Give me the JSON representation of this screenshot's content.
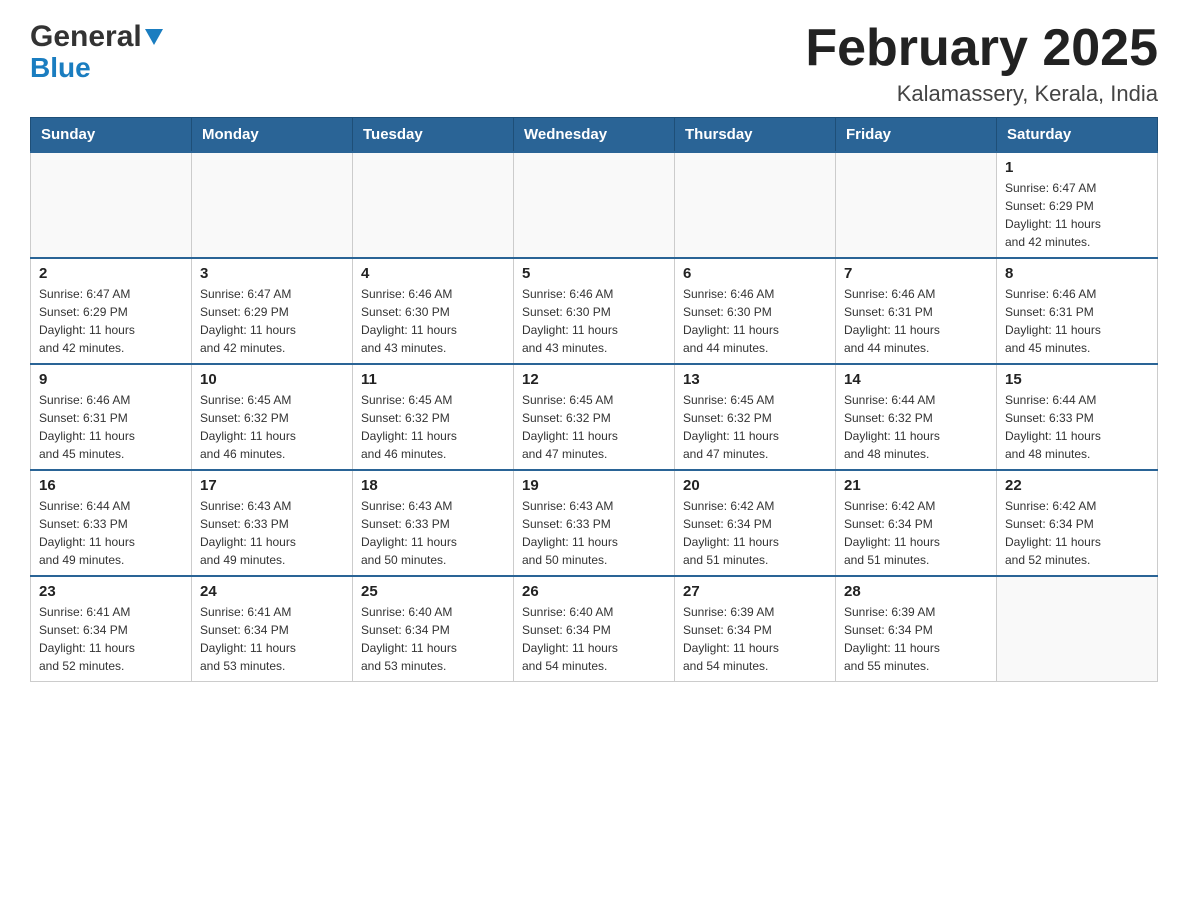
{
  "header": {
    "logo_general": "General",
    "logo_blue": "Blue",
    "title": "February 2025",
    "subtitle": "Kalamassery, Kerala, India"
  },
  "weekdays": [
    "Sunday",
    "Monday",
    "Tuesday",
    "Wednesday",
    "Thursday",
    "Friday",
    "Saturday"
  ],
  "weeks": [
    [
      {
        "day": "",
        "info": ""
      },
      {
        "day": "",
        "info": ""
      },
      {
        "day": "",
        "info": ""
      },
      {
        "day": "",
        "info": ""
      },
      {
        "day": "",
        "info": ""
      },
      {
        "day": "",
        "info": ""
      },
      {
        "day": "1",
        "info": "Sunrise: 6:47 AM\nSunset: 6:29 PM\nDaylight: 11 hours\nand 42 minutes."
      }
    ],
    [
      {
        "day": "2",
        "info": "Sunrise: 6:47 AM\nSunset: 6:29 PM\nDaylight: 11 hours\nand 42 minutes."
      },
      {
        "day": "3",
        "info": "Sunrise: 6:47 AM\nSunset: 6:29 PM\nDaylight: 11 hours\nand 42 minutes."
      },
      {
        "day": "4",
        "info": "Sunrise: 6:46 AM\nSunset: 6:30 PM\nDaylight: 11 hours\nand 43 minutes."
      },
      {
        "day": "5",
        "info": "Sunrise: 6:46 AM\nSunset: 6:30 PM\nDaylight: 11 hours\nand 43 minutes."
      },
      {
        "day": "6",
        "info": "Sunrise: 6:46 AM\nSunset: 6:30 PM\nDaylight: 11 hours\nand 44 minutes."
      },
      {
        "day": "7",
        "info": "Sunrise: 6:46 AM\nSunset: 6:31 PM\nDaylight: 11 hours\nand 44 minutes."
      },
      {
        "day": "8",
        "info": "Sunrise: 6:46 AM\nSunset: 6:31 PM\nDaylight: 11 hours\nand 45 minutes."
      }
    ],
    [
      {
        "day": "9",
        "info": "Sunrise: 6:46 AM\nSunset: 6:31 PM\nDaylight: 11 hours\nand 45 minutes."
      },
      {
        "day": "10",
        "info": "Sunrise: 6:45 AM\nSunset: 6:32 PM\nDaylight: 11 hours\nand 46 minutes."
      },
      {
        "day": "11",
        "info": "Sunrise: 6:45 AM\nSunset: 6:32 PM\nDaylight: 11 hours\nand 46 minutes."
      },
      {
        "day": "12",
        "info": "Sunrise: 6:45 AM\nSunset: 6:32 PM\nDaylight: 11 hours\nand 47 minutes."
      },
      {
        "day": "13",
        "info": "Sunrise: 6:45 AM\nSunset: 6:32 PM\nDaylight: 11 hours\nand 47 minutes."
      },
      {
        "day": "14",
        "info": "Sunrise: 6:44 AM\nSunset: 6:32 PM\nDaylight: 11 hours\nand 48 minutes."
      },
      {
        "day": "15",
        "info": "Sunrise: 6:44 AM\nSunset: 6:33 PM\nDaylight: 11 hours\nand 48 minutes."
      }
    ],
    [
      {
        "day": "16",
        "info": "Sunrise: 6:44 AM\nSunset: 6:33 PM\nDaylight: 11 hours\nand 49 minutes."
      },
      {
        "day": "17",
        "info": "Sunrise: 6:43 AM\nSunset: 6:33 PM\nDaylight: 11 hours\nand 49 minutes."
      },
      {
        "day": "18",
        "info": "Sunrise: 6:43 AM\nSunset: 6:33 PM\nDaylight: 11 hours\nand 50 minutes."
      },
      {
        "day": "19",
        "info": "Sunrise: 6:43 AM\nSunset: 6:33 PM\nDaylight: 11 hours\nand 50 minutes."
      },
      {
        "day": "20",
        "info": "Sunrise: 6:42 AM\nSunset: 6:34 PM\nDaylight: 11 hours\nand 51 minutes."
      },
      {
        "day": "21",
        "info": "Sunrise: 6:42 AM\nSunset: 6:34 PM\nDaylight: 11 hours\nand 51 minutes."
      },
      {
        "day": "22",
        "info": "Sunrise: 6:42 AM\nSunset: 6:34 PM\nDaylight: 11 hours\nand 52 minutes."
      }
    ],
    [
      {
        "day": "23",
        "info": "Sunrise: 6:41 AM\nSunset: 6:34 PM\nDaylight: 11 hours\nand 52 minutes."
      },
      {
        "day": "24",
        "info": "Sunrise: 6:41 AM\nSunset: 6:34 PM\nDaylight: 11 hours\nand 53 minutes."
      },
      {
        "day": "25",
        "info": "Sunrise: 6:40 AM\nSunset: 6:34 PM\nDaylight: 11 hours\nand 53 minutes."
      },
      {
        "day": "26",
        "info": "Sunrise: 6:40 AM\nSunset: 6:34 PM\nDaylight: 11 hours\nand 54 minutes."
      },
      {
        "day": "27",
        "info": "Sunrise: 6:39 AM\nSunset: 6:34 PM\nDaylight: 11 hours\nand 54 minutes."
      },
      {
        "day": "28",
        "info": "Sunrise: 6:39 AM\nSunset: 6:34 PM\nDaylight: 11 hours\nand 55 minutes."
      },
      {
        "day": "",
        "info": ""
      }
    ]
  ]
}
